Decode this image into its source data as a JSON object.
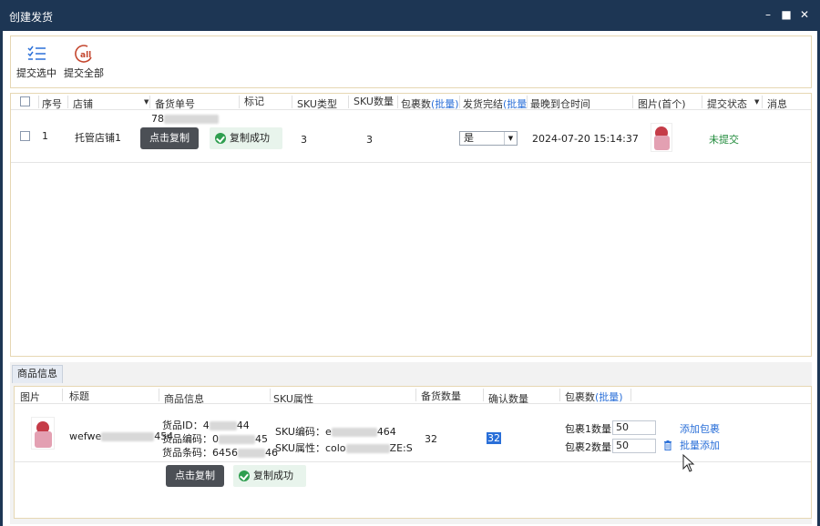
{
  "window": {
    "title": "创建发货"
  },
  "toolbar": {
    "submit_selected": "提交选中",
    "submit_all": "提交全部"
  },
  "grid": {
    "headers": {
      "seq": "序号",
      "shop": "店铺",
      "stock_no": "备货单号",
      "mark": "标记",
      "sku_type": "SKU类型",
      "sku_qty": "SKU数量",
      "pkg_count": "包裹数",
      "batch": "(批量)",
      "ship_done": "发货完结",
      "batch2": "(批量",
      "latest_arrival": "最晚到仓时间",
      "image": "图片(首个)",
      "status": "提交状态",
      "message": "消息"
    },
    "rows": [
      {
        "seq": "1",
        "shop": "托管店铺1",
        "stock_no_prefix": "78",
        "sku_type": "3",
        "sku_qty": "3",
        "ship_done": "是",
        "latest_arrival": "2024-07-20 15:14:37",
        "status": "未提交"
      }
    ],
    "copy_button": "点击复制",
    "copy_success": "复制成功"
  },
  "product_panel": {
    "tab": "商品信息",
    "headers": {
      "image": "图片",
      "title": "标题",
      "info": "商品信息",
      "sku_attr": "SKU属性",
      "stock_qty": "备货数量",
      "confirm_qty": "确认数量",
      "pkg_count": "包裹数",
      "batch": "(批量)"
    },
    "row": {
      "title_prefix": "wefwe",
      "title_suffix": "454",
      "goods_id_label": "货品ID：",
      "goods_id_prefix": "4",
      "goods_id_suffix": "44",
      "goods_code_label": "货品编码：",
      "goods_code_prefix": "0",
      "goods_code_suffix": "45",
      "goods_barcode_label": "货品条码：",
      "goods_barcode_prefix": "6456",
      "goods_barcode_suffix": "46",
      "sku_code_label": "SKU编码：",
      "sku_code_prefix": "e",
      "sku_code_suffix": "464",
      "sku_attr_label": "SKU属性：",
      "sku_attr_prefix": "colo",
      "sku_attr_suffix": "ZE:S",
      "stock_qty": "32",
      "confirm_qty": "32",
      "pkg1_label": "包裹1数量",
      "pkg1_value": "50",
      "pkg2_label": "包裹2数量",
      "pkg2_value": "50",
      "add_package": "添加包裹",
      "batch_add": "批量添加"
    },
    "copy_button": "点击复制",
    "copy_success": "复制成功"
  },
  "colors": {
    "titlebar": "#1d3654",
    "link": "#2a6fd8",
    "status_green": "#1f8a3a",
    "panel_border": "#e6d7b3"
  }
}
